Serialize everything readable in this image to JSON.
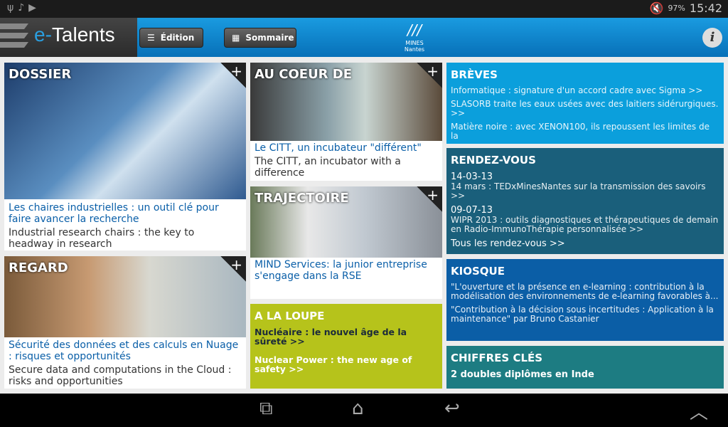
{
  "status": {
    "time": "15:42",
    "battery": "97%"
  },
  "header": {
    "brand_prefix": "e-",
    "brand_name": "Talents",
    "edition_label": "Édition",
    "sommaire_label": "Sommaire",
    "logo_line1": "MINES",
    "logo_line2": "Nantes",
    "info_label": "i"
  },
  "dossier": {
    "tag": "DOSSIER",
    "title_fr": "Les chaires industrielles : un outil clé pour faire avancer la recherche",
    "title_en": "Industrial research chairs : the key to headway in research"
  },
  "regard": {
    "tag": "REGARD",
    "title_fr": "Sécurité des données et des calculs en Nuage : risques et opportunités",
    "title_en": "Secure data and computations in the Cloud : risks and opportunities"
  },
  "coeur": {
    "tag": "AU COEUR DE",
    "title_fr": "Le CITT, un incubateur \"différent\"",
    "title_en": "The CITT,  an incubator with a difference"
  },
  "trajectoire": {
    "tag": "TRAJECTOIRE",
    "title_fr": "MIND Services: la junior entreprise s'engage dans la RSE"
  },
  "loupe": {
    "tag": "A LA LOUPE",
    "item1": "Nucléaire : le nouvel âge de la sûreté  >>",
    "item2": "Nuclear Power : the new age of safety  >>"
  },
  "breves": {
    "title": "BRÈVES",
    "items": [
      "Informatique : signature d'un accord cadre avec Sigma    >>",
      "SLASORB traite les eaux usées avec des laitiers sidérurgiques.   >>",
      "Matière noire : avec XENON100, ils repoussent les limites de la"
    ]
  },
  "rdv": {
    "title": "RENDEZ-VOUS",
    "items": [
      {
        "date": "14-03-13",
        "text": "14 mars : TEDxMinesNantes sur la transmission des savoirs   >>"
      },
      {
        "date": "09-07-13",
        "text": "WIPR 2013 : outils diagnostiques et thérapeutiques de demain en Radio-ImmunoThérapie personnalisée   >>"
      }
    ],
    "all": "Tous les rendez-vous  >>"
  },
  "kiosque": {
    "title": "KIOSQUE",
    "items": [
      "\"L'ouverture et la présence en e-learning : contribution à la modélisation des environnements de e-learning favorables à...",
      "\"Contribution à la décision sous incertitudes : Application à la maintenance\" par Bruno Castanier"
    ]
  },
  "chiffres": {
    "title": "CHIFFRES CLÉS",
    "item": "2 doubles diplômes en Inde"
  },
  "colors": {
    "breves": "#0b9fdc",
    "rdv": "#1a5f7b",
    "kiosque": "#0b5ea6",
    "chiffres": "#1d7c82",
    "loupe": "#b6c31b",
    "link": "#0a5fa8"
  }
}
